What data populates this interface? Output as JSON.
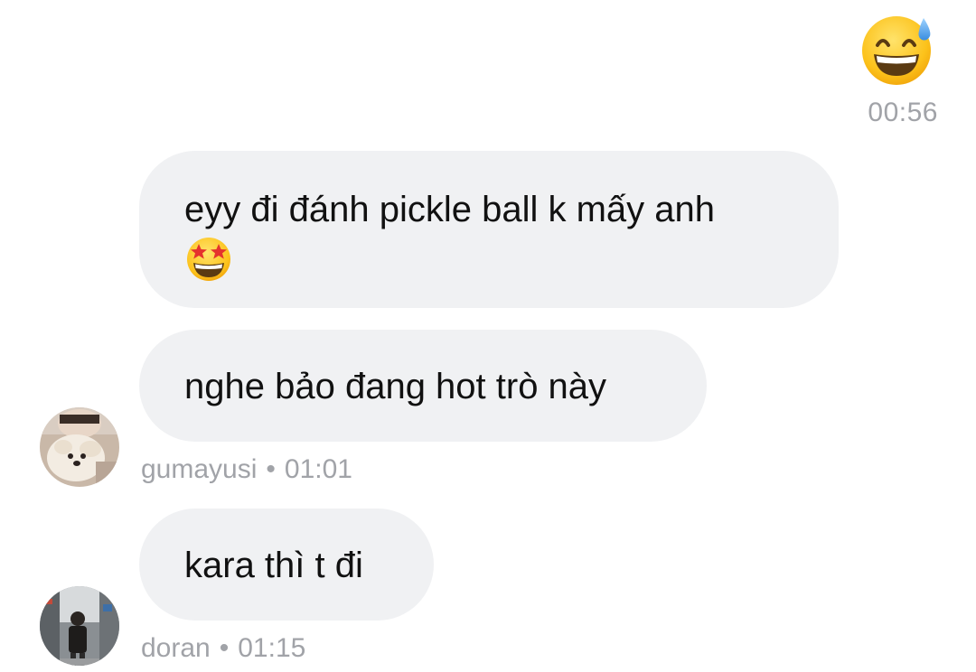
{
  "sent": {
    "emoji_icon": "grinning-face-with-sweat-icon",
    "time": "00:56"
  },
  "messages": [
    {
      "text": "eyy đi đánh pickle ball k mấy anh",
      "trailing_emoji": "star-struck-icon"
    },
    {
      "text": "nghe bảo đang hot trò này",
      "sender": "gumayusi",
      "time": "01:01",
      "separator": "•"
    },
    {
      "text": "kara thì t đi",
      "sender": "doran",
      "time": "01:15",
      "separator": "•"
    }
  ],
  "colors": {
    "bubble_bg": "#f0f1f3",
    "meta_text": "#a1a3a8",
    "message_text": "#111111"
  }
}
